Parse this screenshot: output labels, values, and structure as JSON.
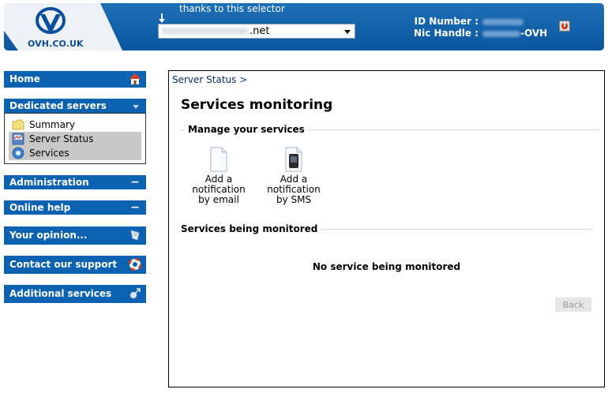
{
  "header": {
    "logo_text": "OVH.CO.UK",
    "selector_caption": "thanks to this selector",
    "domain_tld": ".net",
    "id_number_label": "ID Number :",
    "nic_handle_label": "Nic Handle :",
    "nic_handle_suffix": "-OVH"
  },
  "sidebar": {
    "home": "Home",
    "dedicated_servers": "Dedicated servers",
    "submenu": [
      {
        "label": "Summary",
        "icon": "folder-icon"
      },
      {
        "label": "Server Status",
        "icon": "server-status-icon"
      },
      {
        "label": "Services",
        "icon": "services-icon"
      }
    ],
    "administration": "Administration",
    "online_help": "Online help",
    "your_opinion": "Your opinion...",
    "contact_support": "Contact our support",
    "additional_services": "Additional services",
    "collapse_symbol": "−"
  },
  "main": {
    "breadcrumb": "Server Status >",
    "title": "Services monitoring",
    "manage_section": "Manage your services",
    "actions": [
      {
        "line1": "Add a",
        "line2": "notification",
        "line3": "by email"
      },
      {
        "line1": "Add a",
        "line2": "notification",
        "line3": "by SMS"
      }
    ],
    "monitored_section": "Services being monitored",
    "empty_message": "No service being monitored",
    "back_label": "Back"
  },
  "colors": {
    "header_blue": "#0a56a0",
    "menu_blue": "#0a62b0",
    "selected_gray": "#c8c8c8"
  }
}
